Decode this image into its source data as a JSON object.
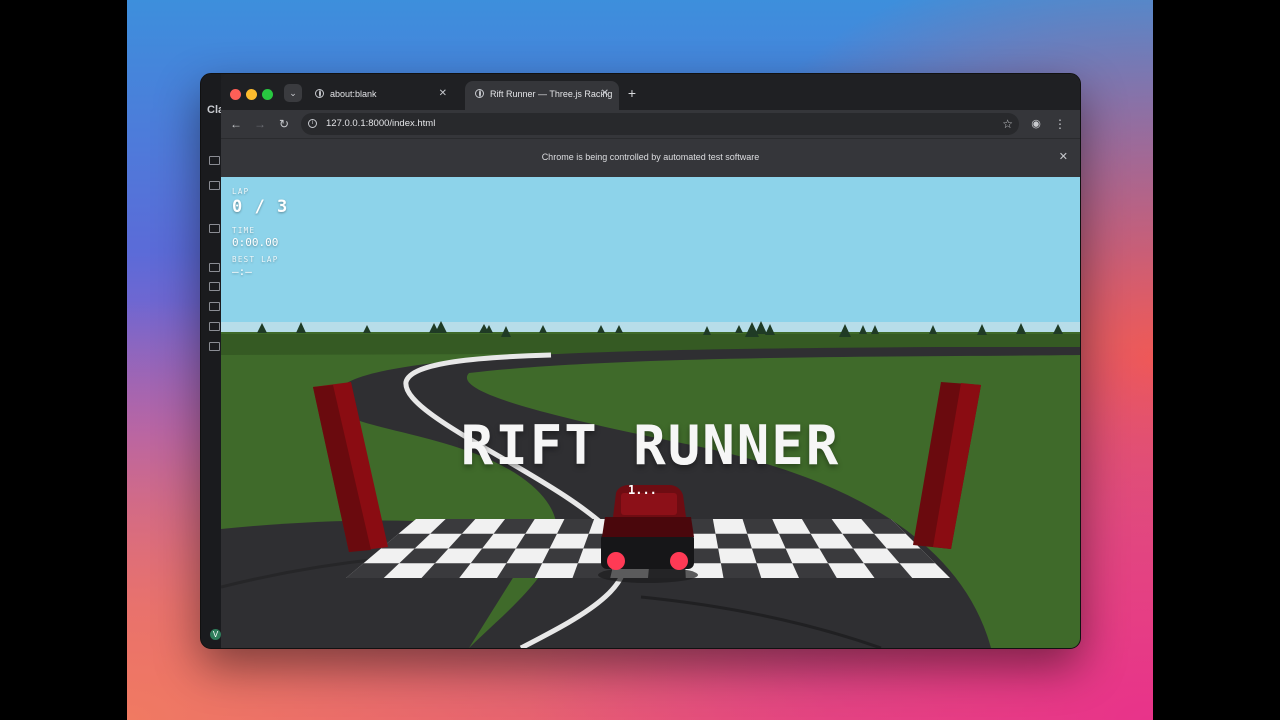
{
  "browser": {
    "tabs": [
      {
        "label": "about:blank",
        "active": false
      },
      {
        "label": "Rift Runner — Three.js Racing",
        "active": true
      }
    ],
    "url": "127.0.0.1:8000/index.html",
    "infobar_message": "Chrome is being controlled by automated test software"
  },
  "sidebar": {
    "title": "Cla",
    "avatar": "V"
  },
  "game": {
    "lap_label": "LAP",
    "lap_value": "0 / 3",
    "time_label": "TIME",
    "time_value": "0:00.00",
    "best_lap_label": "BEST LAP",
    "best_lap_value": "—:—",
    "title": "RIFT RUNNER",
    "countdown": "1..."
  },
  "colors": {
    "sky": "#8dd3ea",
    "grass": "#3f6a2a",
    "road": "#2f2f32",
    "car_red": "#7a0e14",
    "gate_red": "#8a0c12",
    "tail_light": "#ff3a55"
  }
}
